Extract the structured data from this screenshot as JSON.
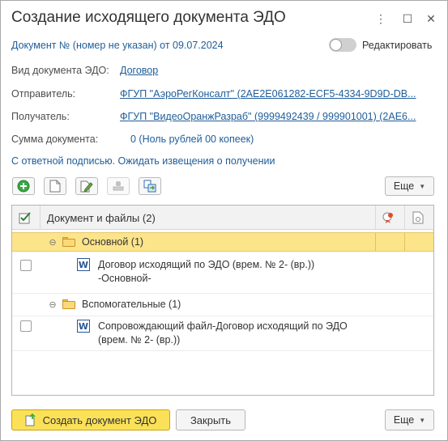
{
  "window": {
    "title": "Создание исходящего документа ЭДО",
    "menu_glyph": "⋮",
    "maximize_glyph": "☐",
    "close_glyph": "✕"
  },
  "header": {
    "doc_line": "Документ № (номер не указан) от 09.07.2024",
    "edit_toggle_label": "Редактировать"
  },
  "fields": {
    "doc_type_label": "Вид документа ЭДО:",
    "doc_type_value": "Договор",
    "sender_label": "Отправитель:",
    "sender_value": "ФГУП \"АэроРегКонсалт\" (2AE2E061282-ECF5-4334-9D9D-DB...",
    "recipient_label": "Получатель:",
    "recipient_value": "ФГУП \"ВидеоОранжРазраб\" (9999492439 / 999901001) (2AE6...",
    "sum_label": "Сумма документа:",
    "sum_value": "0 (Ноль рублей 00 копеек)"
  },
  "signature_note": "С ответной подписью. Ожидать извещения о получении",
  "toolbar": {
    "more_label": "Еще",
    "icons": [
      "add-icon",
      "new-document-icon",
      "edit-document-icon",
      "stamp-icon",
      "copy-files-icon"
    ]
  },
  "table": {
    "header_label": "Документ и файлы (2)",
    "groups": [
      {
        "label": "Основной (1)",
        "file": "Договор исходящий по ЭДО (врем. № 2- (вр.))",
        "file_line2": "-Основной-"
      },
      {
        "label": "Вспомогательные (1)",
        "file": "Сопровождающий файл-Договор исходящий по ЭДО",
        "file_line2": "(врем. № 2- (вр.))"
      }
    ]
  },
  "footer": {
    "create_label": "Создать документ ЭДО",
    "close_label": "Закрыть",
    "more_label": "Еще"
  },
  "colors": {
    "accent_yellow": "#fbe158",
    "link_blue": "#1f5d99",
    "selection": "#fce48a"
  }
}
